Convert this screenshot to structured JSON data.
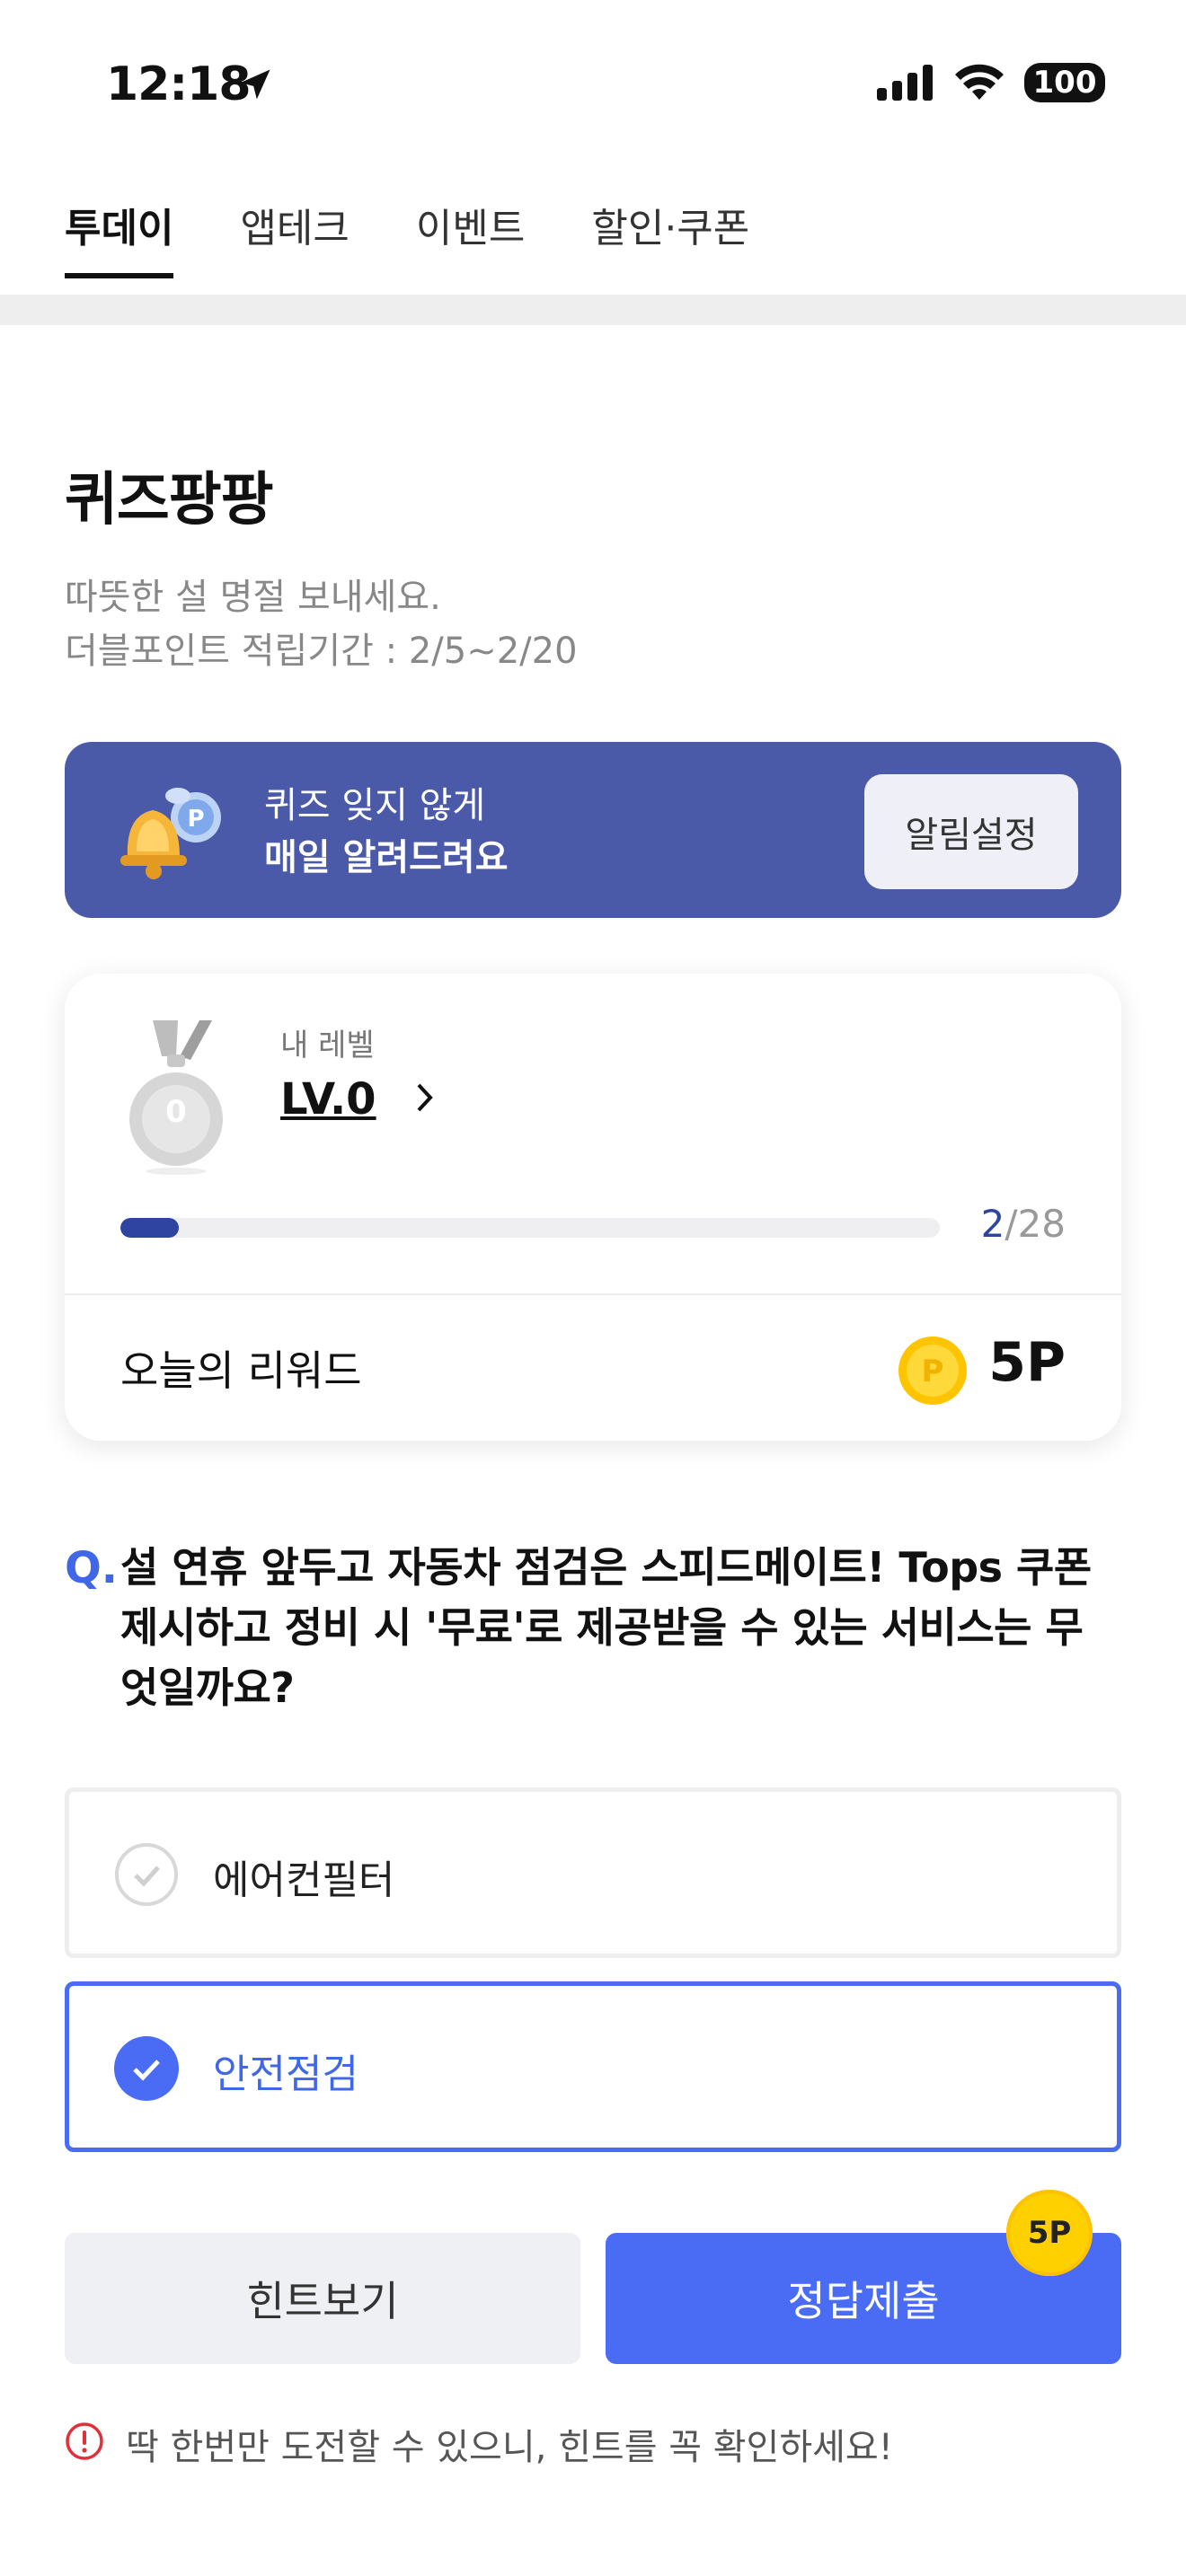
{
  "status_bar": {
    "time": "12:18",
    "battery": "100"
  },
  "tabs": [
    {
      "label": "투데이",
      "active": true
    },
    {
      "label": "앱테크",
      "active": false
    },
    {
      "label": "이벤트",
      "active": false
    },
    {
      "label": "할인·쿠폰",
      "active": false
    }
  ],
  "page": {
    "title": "퀴즈팡팡",
    "subtitle_1": "따뜻한 설 명절 보내세요.",
    "subtitle_2": "더블포인트 적립기간 : 2/5~2/20"
  },
  "banner": {
    "line_1": "퀴즈 잊지 않게",
    "line_2": "매일 알려드려요",
    "button_label": "알림설정"
  },
  "level_card": {
    "label": "내 레벨",
    "level": "LV.0",
    "medal_number": "0",
    "progress_current": "2",
    "progress_total": "/28",
    "progress_fraction": 0.0714,
    "reward_label": "오늘의 리워드",
    "reward_value": "5P"
  },
  "question": {
    "prefix": "Q.",
    "text": "설 연휴 앞두고 자동차 점검은 스피드메이트! Tops 쿠폰 제시하고 정비 시 '무료'로 제공받을 수 있는 서비스는 무엇일까요?"
  },
  "options": [
    {
      "label": "에어컨필터",
      "selected": false
    },
    {
      "label": "안전점검",
      "selected": true
    }
  ],
  "actions": {
    "hint_label": "힌트보기",
    "submit_label": "정답제출",
    "submit_badge": "5P"
  },
  "notice": "딱 한번만 도전할 수 있으니, 힌트를 꼭 확인하세요!",
  "colors": {
    "accent": "#4a6cf5",
    "banner_bg": "#4a5aa8",
    "progress": "#2f44a0",
    "coin": "#ffd000",
    "warning": "#e0303a"
  }
}
